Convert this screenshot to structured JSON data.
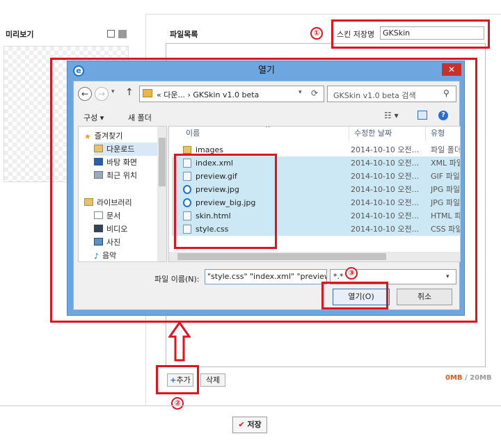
{
  "left_panel": {
    "title": "미리보기"
  },
  "file_panel": {
    "title": "파일목록"
  },
  "skin_name": {
    "label": "스킨 저장명",
    "value": "GKSkin"
  },
  "annotations": {
    "n1": "①",
    "n2": "②",
    "n3": "③",
    "accent": "#e0141e"
  },
  "add_button": {
    "label": "추가",
    "icon": "plus-icon"
  },
  "delete_button": {
    "label": "삭제"
  },
  "quota": {
    "used": "0MB",
    "sep": " / ",
    "total": "20MB"
  },
  "save_button": {
    "label": "저장",
    "icon": "check-icon"
  },
  "dialog": {
    "title": "열기",
    "close": "✕",
    "address": "« 다운... › GKSkin v1.0 beta",
    "search_placeholder": "GKSkin v1.0 beta 검색",
    "toolbar": {
      "organize": "구성 ▾",
      "new_folder": "새 폴더"
    },
    "nav": [
      {
        "label": "즐겨찾기",
        "icon": "star-icon"
      },
      {
        "label": "다운로드",
        "icon": "download-folder-icon"
      },
      {
        "label": "바탕 화면",
        "icon": "desktop-icon"
      },
      {
        "label": "최근 위치",
        "icon": "recent-icon"
      },
      {
        "label": "라이브러리",
        "icon": "library-icon"
      },
      {
        "label": "문서",
        "icon": "document-icon"
      },
      {
        "label": "비디오",
        "icon": "video-icon"
      },
      {
        "label": "사진",
        "icon": "picture-icon"
      },
      {
        "label": "음악",
        "icon": "music-icon"
      }
    ],
    "columns": {
      "name": "이름",
      "date": "수정한 날짜",
      "type": "유형"
    },
    "files": [
      {
        "name": "images",
        "date": "2014-10-10 오전...",
        "type": "파일 폴더",
        "selected": false,
        "icon": "folder"
      },
      {
        "name": "index.xml",
        "date": "2014-10-10 오전...",
        "type": "XML 파일",
        "selected": true,
        "icon": "file"
      },
      {
        "name": "preview.gif",
        "date": "2014-10-10 오전...",
        "type": "GIF 파일",
        "selected": true,
        "icon": "file"
      },
      {
        "name": "preview.jpg",
        "date": "2014-10-10 오전...",
        "type": "JPG 파일",
        "selected": true,
        "icon": "ie"
      },
      {
        "name": "preview_big.jpg",
        "date": "2014-10-10 오전...",
        "type": "JPG 파일",
        "selected": true,
        "icon": "ie"
      },
      {
        "name": "skin.html",
        "date": "2014-10-10 오전...",
        "type": "HTML 파일",
        "selected": true,
        "icon": "file"
      },
      {
        "name": "style.css",
        "date": "2014-10-10 오전...",
        "type": "CSS 파일",
        "selected": true,
        "icon": "file"
      }
    ],
    "filename_label": "파일 이름(N):",
    "filename_value": "\"style.css\" \"index.xml\" \"preview",
    "filter_value": "*.*",
    "open_button": "열기(O)",
    "cancel_button": "취소"
  }
}
